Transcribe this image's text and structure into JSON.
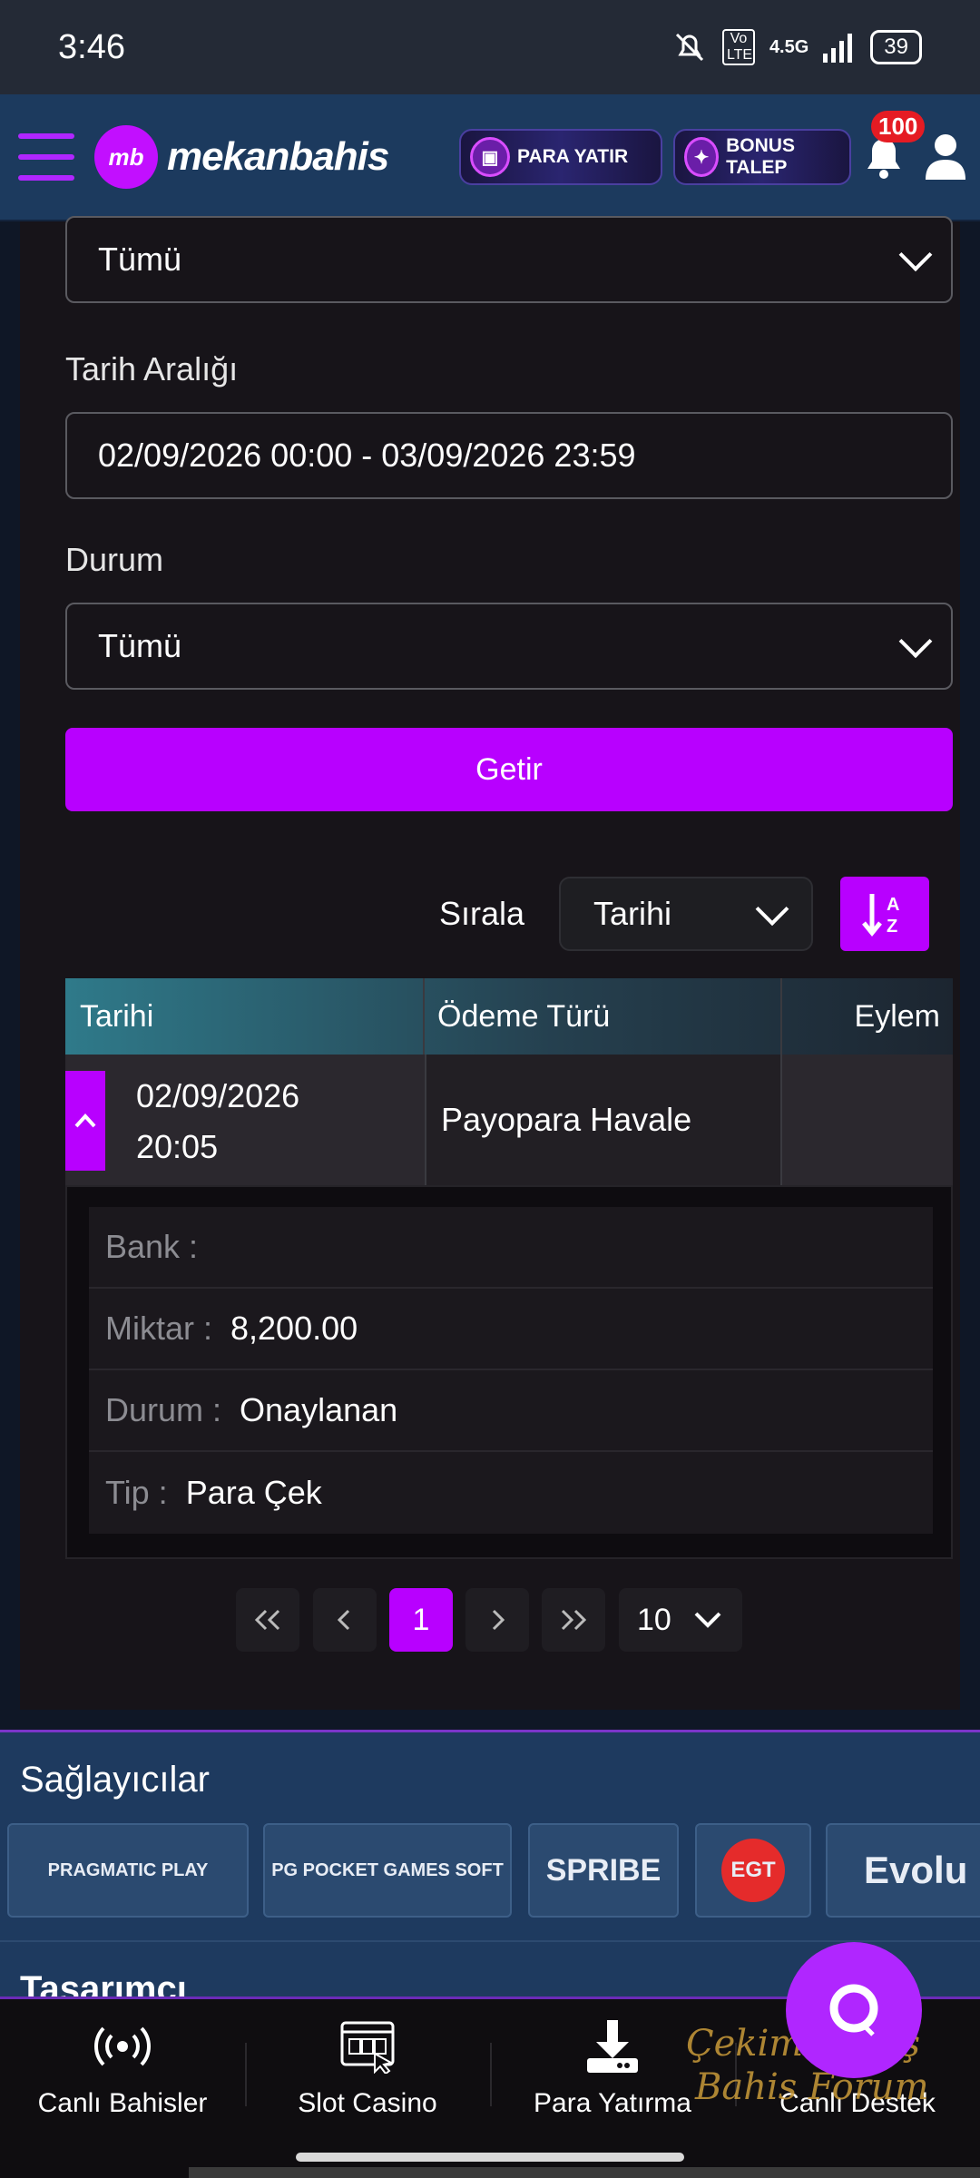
{
  "status_bar": {
    "time": "3:46",
    "network": "4.5G",
    "volte": "Vo LTE",
    "battery": "39"
  },
  "header": {
    "logo_mark": "mb",
    "logo_text": "mekanbahis",
    "deposit_button": "PARA YATIR",
    "bonus_button": "BONUS TALEP",
    "notification_count": "100"
  },
  "filters": {
    "type_value": "Tümü",
    "date_range_label": "Tarih Aralığı",
    "date_range_value": "02/09/2026 00:00 - 03/09/2026 23:59",
    "status_label": "Durum",
    "status_value": "Tümü",
    "submit_button": "Getir"
  },
  "sort": {
    "label": "Sırala",
    "value": "Tarihi"
  },
  "table": {
    "headers": [
      "Tarihi",
      "Ödeme Türü",
      "Eylem"
    ],
    "row": {
      "date": "02/09/2026",
      "time": "20:05",
      "payment_type": "Payopara Havale"
    },
    "details": [
      {
        "key": "Bank :",
        "value": ""
      },
      {
        "key": "Miktar :",
        "value": "8,200.00"
      },
      {
        "key": "Durum :",
        "value": "Onaylanan"
      },
      {
        "key": "Tip :",
        "value": "Para Çek"
      }
    ]
  },
  "pagination": {
    "current_page": "1",
    "page_size": "10"
  },
  "providers": {
    "title": "Sağlayıcılar",
    "items": [
      "PRAGMATIC PLAY",
      "PG POCKET GAMES SOFT",
      "SPRIBE",
      "EGT",
      "Evolu"
    ]
  },
  "designers": {
    "title": "Tasarımcı"
  },
  "bottom_nav": [
    "Canlı Bahisler",
    "Slot Casino",
    "Para Yatırma",
    "Canlı Destek"
  ],
  "watermark": {
    "line1": "ÇekimPaylaş",
    "line2": "Bahis Forum"
  },
  "colors": {
    "accent": "#b800ff",
    "header_bg": "#1c3a5e",
    "card_bg": "#171419",
    "badge": "#e51b23"
  }
}
